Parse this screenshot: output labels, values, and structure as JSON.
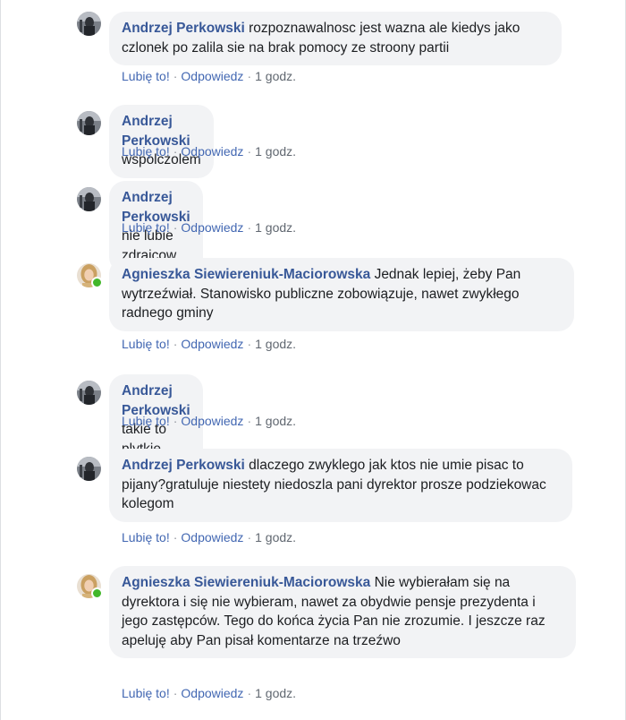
{
  "comments": [
    {
      "author": "Andrzej Perkowski",
      "text": "rozpoznawalnosc jest wazna ale kiedys jako czlonek po zalila sie na brak pomocy ze stroony partii",
      "like": "Lubię to!",
      "reply": "Odpowiedz",
      "dot": "·",
      "time": "1 godz.",
      "online": false
    },
    {
      "author": "Andrzej Perkowski",
      "text": "wspolczolem",
      "like": "Lubię to!",
      "reply": "Odpowiedz",
      "dot": "·",
      "time": "1 godz.",
      "online": false
    },
    {
      "author": "Andrzej Perkowski",
      "text": "nie lubie zdrajcow",
      "like": "Lubię to!",
      "reply": "Odpowiedz",
      "dot": "·",
      "time": "1 godz.",
      "online": false
    },
    {
      "author": "Agnieszka Siewiereniuk-Maciorowska",
      "text": "Jednak lepiej, żeby Pan wytrzeźwiał. Stanowisko publiczne zobowiązuje, nawet zwykłego radnego gminy",
      "like": "Lubię to!",
      "reply": "Odpowiedz",
      "dot": "·",
      "time": "1 godz.",
      "online": true
    },
    {
      "author": "Andrzej Perkowski",
      "text": "takie to plytkie szkoda mi Pani",
      "like": "Lubię to!",
      "reply": "Odpowiedz",
      "dot": "·",
      "time": "1 godz.",
      "online": false
    },
    {
      "author": "Andrzej Perkowski",
      "text": "dlaczego zwyklego jak ktos nie umie pisac to pijany?gratuluje niestety niedoszla pani dyrektor prosze podziekowac kolegom",
      "like": "Lubię to!",
      "reply": "Odpowiedz",
      "dot": "·",
      "time": "1 godz.",
      "online": false
    },
    {
      "author": "Agnieszka Siewiereniuk-Maciorowska",
      "text": "Nie wybierałam się na dyrektora i się nie wybieram, nawet za obydwie pensje prezydenta i jego zastępców. Tego do końca życia Pan nie zrozumie. I jeszcze raz apeluję aby Pan pisał komentarze na trzeźwo",
      "like": "Lubię to!",
      "reply": "Odpowiedz",
      "dot": "·",
      "time": "1 godz.",
      "online": true
    }
  ],
  "colors": {
    "author_link": "#385898",
    "action_link": "#4267b2",
    "bubble_bg": "#f2f3f5",
    "online": "#42b72a"
  }
}
